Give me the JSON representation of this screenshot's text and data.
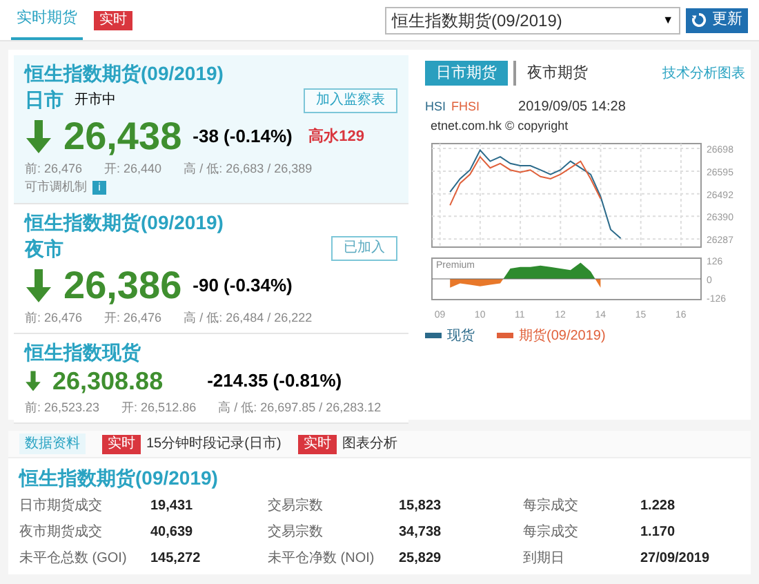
{
  "top_tabs": [
    {
      "label": "实时期货",
      "selected": true,
      "badge": "实时"
    }
  ],
  "contract_select": {
    "value": "恒生指数期货(09/2019)",
    "arrow": "▼"
  },
  "refresh_button": {
    "label": "更新"
  },
  "quotes": [
    {
      "kind": "futures",
      "title": "恒生指数期货(09/2019)",
      "session": "日市",
      "status": "开市中",
      "action": "加入监察表",
      "added": false,
      "price": "26,438",
      "change": "-38 (-0.14%)",
      "premium": "高水129",
      "falling": true,
      "prev": "前: 26,476",
      "open": "开: 26,440",
      "high_low": "高 / 低: 26,683 / 26,389",
      "note": "可市调机制",
      "note_icon": "i",
      "highlighted": true
    },
    {
      "kind": "futures",
      "title": "恒生指数期货(09/2019)",
      "session": "夜市",
      "action": "已加入",
      "added": true,
      "price": "26,386",
      "change": "-90 (-0.34%)",
      "falling": true,
      "prev": "前: 26,476",
      "open": "开: 26,476",
      "high_low": "高 / 低: 26,484 / 26,222",
      "highlighted": false
    },
    {
      "kind": "spot",
      "title": "恒生指数现货",
      "price": "26,308.88",
      "change": "-214.35 (-0.81%)",
      "falling": true,
      "prev": "前: 26,523.23",
      "open": "开: 26,512.86",
      "high_low": "高 / 低: 26,697.85 / 26,283.12",
      "highlighted": false
    }
  ],
  "chart_panel": {
    "tabs": [
      {
        "label": "日市期货",
        "selected": true
      },
      {
        "label": "夜市期货",
        "selected": false
      }
    ],
    "link": "技术分析图表",
    "symbols": [
      "HSI",
      "FHSI"
    ],
    "timestamp": "2019/09/05 14:28",
    "copyright": "etnet.com.hk © copyright",
    "chart_data": {
      "type": "line",
      "grid": true,
      "ylim": [
        26250,
        26720
      ],
      "yticks": [
        26287,
        26390,
        26492,
        26595,
        26698
      ],
      "series": [
        {
          "name": "现货",
          "color": "#2b6a8a",
          "values": [
            null,
            26500,
            26560,
            26600,
            26690,
            26640,
            26660,
            26630,
            26620,
            26620,
            26600,
            26580,
            26600,
            26640,
            26610,
            26580,
            26480,
            26330,
            26290,
            null,
            null,
            null,
            null,
            null,
            null
          ]
        },
        {
          "name": "期货(09/2019)",
          "color": "#e0603a",
          "values": [
            null,
            26440,
            26540,
            26580,
            26660,
            26610,
            26630,
            26600,
            26590,
            26600,
            26570,
            26560,
            26580,
            26610,
            26640,
            26560,
            26470,
            null,
            null,
            null,
            null,
            null,
            null,
            null,
            null
          ]
        }
      ]
    },
    "premium_chart": {
      "label": "Premium",
      "chart_data": {
        "type": "area",
        "categories": [
          "09",
          null,
          null,
          null,
          "10",
          null,
          null,
          null,
          "11",
          null,
          null,
          null,
          "12",
          null,
          null,
          null,
          "14",
          null,
          null,
          null,
          "15",
          null,
          null,
          null,
          "16"
        ],
        "values": [
          null,
          -60,
          -30,
          -40,
          -50,
          -40,
          -30,
          70,
          80,
          80,
          90,
          80,
          70,
          60,
          110,
          50,
          -60,
          null,
          null,
          null,
          null,
          null,
          null,
          null,
          null
        ],
        "ylim": [
          -140,
          140
        ],
        "yticks": [
          -126,
          0,
          126
        ]
      }
    }
  },
  "bottom_tabs": [
    {
      "label": "数据资料",
      "selected": true
    },
    {
      "label": "15分钟时段记录(日市)",
      "badge": "实时",
      "selected": false
    },
    {
      "label": "图表分析",
      "badge": "实时",
      "selected": false
    }
  ],
  "stats": {
    "title": "恒生指数期货(09/2019)",
    "rows": [
      [
        "日市期货成交",
        "19,431",
        "交易宗数",
        "15,823",
        "每宗成交",
        "1.228"
      ],
      [
        "夜市期货成交",
        "40,639",
        "交易宗数",
        "34,738",
        "每宗成交",
        "1.170"
      ],
      [
        "未平仓总数 (GOI)",
        "145,272",
        "未平仓净数 (NOI)",
        "25,829",
        "到期日",
        "27/09/2019"
      ]
    ]
  }
}
